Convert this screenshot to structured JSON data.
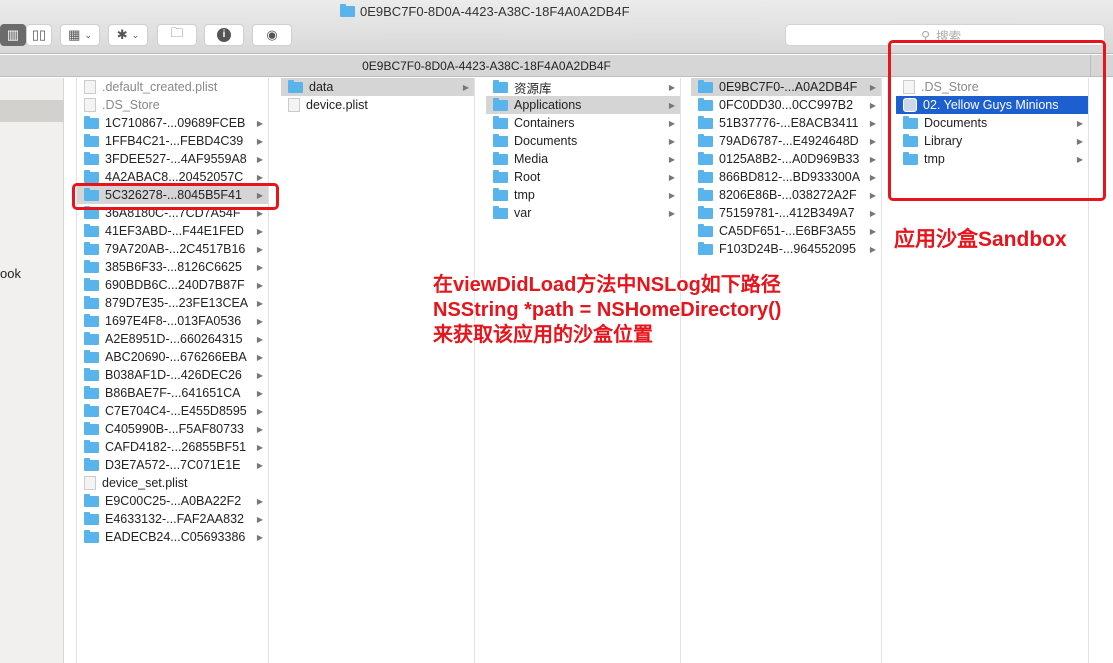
{
  "window": {
    "title": "0E9BC7F0-8D0A-4423-A38C-18F4A0A2DB4F",
    "path": "0E9BC7F0-8D0A-4423-A38C-18F4A0A2DB4F",
    "search_placeholder": "搜索"
  },
  "toolbar": {
    "buttons": [
      "column-view",
      "coverflow-view",
      "arrange",
      "action",
      "new-folder",
      "get-info",
      "quick-look"
    ]
  },
  "sidebar": {
    "partial_label": "ook"
  },
  "columns": [
    [
      {
        "n": ".default_created.plist",
        "t": "file"
      },
      {
        "n": ".DS_Store",
        "t": "file"
      },
      {
        "n": "1C710867-...09689FCEB",
        "t": "folder"
      },
      {
        "n": "1FFB4C21-...FEBD4C39",
        "t": "folder"
      },
      {
        "n": "3FDEE527-...4AF9559A8",
        "t": "folder"
      },
      {
        "n": "4A2ABAC8...20452057C",
        "t": "folder"
      },
      {
        "n": "5C326278-...8045B5F41",
        "t": "folder",
        "s": "sel"
      },
      {
        "n": "36A8180C-...7CD7A54F",
        "t": "folder"
      },
      {
        "n": "41EF3ABD-...F44E1FED",
        "t": "folder"
      },
      {
        "n": "79A720AB-...2C4517B16",
        "t": "folder"
      },
      {
        "n": "385B6F33-...8126C6625",
        "t": "folder"
      },
      {
        "n": "690BDB6C...240D7B87F",
        "t": "folder"
      },
      {
        "n": "879D7E35-...23FE13CEA",
        "t": "folder"
      },
      {
        "n": "1697E4F8-...013FA0536",
        "t": "folder"
      },
      {
        "n": "A2E8951D-...660264315",
        "t": "folder"
      },
      {
        "n": "ABC20690-...676266EBA",
        "t": "folder"
      },
      {
        "n": "B038AF1D-...426DEC26",
        "t": "folder"
      },
      {
        "n": "B86BAE7F-...641651CA",
        "t": "folder"
      },
      {
        "n": "C7E704C4-...E455D8595",
        "t": "folder"
      },
      {
        "n": "C405990B-...F5AF80733",
        "t": "folder"
      },
      {
        "n": "CAFD4182-...26855BF51",
        "t": "folder"
      },
      {
        "n": "D3E7A572-...7C071E1E",
        "t": "folder"
      },
      {
        "n": "device_set.plist",
        "t": "file"
      },
      {
        "n": "E9C00C25-...A0BA22F2",
        "t": "folder"
      },
      {
        "n": "E4633132-...FAF2AA832",
        "t": "folder"
      },
      {
        "n": "EADECB24...C05693386",
        "t": "folder"
      }
    ],
    [
      {
        "n": "data",
        "t": "folder",
        "s": "sel"
      },
      {
        "n": "device.plist",
        "t": "file"
      }
    ],
    [
      {
        "n": "资源库",
        "t": "folder"
      },
      {
        "n": "Applications",
        "t": "folder",
        "s": "sel"
      },
      {
        "n": "Containers",
        "t": "folder"
      },
      {
        "n": "Documents",
        "t": "folder"
      },
      {
        "n": "Media",
        "t": "folder"
      },
      {
        "n": "Root",
        "t": "folder"
      },
      {
        "n": "tmp",
        "t": "folder"
      },
      {
        "n": "var",
        "t": "folder"
      }
    ],
    [
      {
        "n": "0E9BC7F0-...A0A2DB4F",
        "t": "folder",
        "s": "sel"
      },
      {
        "n": "0FC0DD30...0CC997B2",
        "t": "folder"
      },
      {
        "n": "51B37776-...E8ACB3411",
        "t": "folder"
      },
      {
        "n": "79AD6787-...E4924648D",
        "t": "folder"
      },
      {
        "n": "0125A8B2-...A0D969B33",
        "t": "folder"
      },
      {
        "n": "866BD812-...BD933300A",
        "t": "folder"
      },
      {
        "n": "8206E86B-...038272A2F",
        "t": "folder"
      },
      {
        "n": "75159781-...412B349A7",
        "t": "folder"
      },
      {
        "n": "CA5DF651-...E6BF3A55",
        "t": "folder"
      },
      {
        "n": "F103D24B-...964552095",
        "t": "folder"
      }
    ],
    [
      {
        "n": ".DS_Store",
        "t": "file"
      },
      {
        "n": "02. Yellow Guys Minions",
        "t": "app",
        "s": "act"
      },
      {
        "n": "Documents",
        "t": "folder"
      },
      {
        "n": "Library",
        "t": "folder"
      },
      {
        "n": "tmp",
        "t": "folder"
      }
    ]
  ],
  "annotations": {
    "sandbox_label": "应用沙盒Sandbox",
    "line1": "在viewDidLoad方法中NSLog如下路径",
    "line2": "NSString *path = NSHomeDirectory()",
    "line3": "来获取该应用的沙盒位置",
    "color": "#e8141b"
  },
  "colors": {
    "folder": "#5ab4ec",
    "selection": "#1e5fd0"
  }
}
